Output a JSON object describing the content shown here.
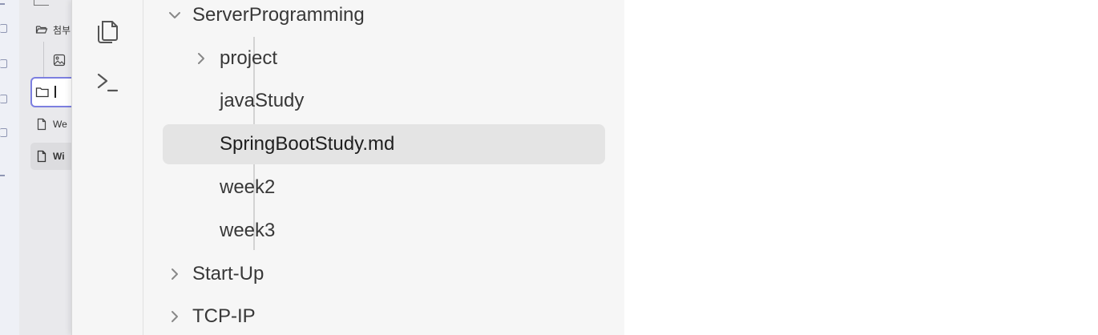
{
  "background_window": {
    "sidebar_items": [
      {
        "icon": "folder-open-icon",
        "label": "첨부"
      },
      {
        "icon": "image-file-icon",
        "label": ""
      },
      {
        "icon": "folder-icon",
        "label": "|",
        "state": "renaming"
      },
      {
        "icon": "file-icon",
        "label": "We"
      },
      {
        "icon": "file-icon",
        "label": "Wi",
        "state": "selected"
      }
    ]
  },
  "overlay": {
    "ribbon": [
      {
        "icon": "files-icon",
        "label": "Files"
      },
      {
        "icon": "terminal-icon",
        "label": "Terminal"
      }
    ],
    "tree": [
      {
        "label": "ServerProgramming",
        "depth": 0,
        "expanded": true,
        "has_children": true
      },
      {
        "label": "project",
        "depth": 1,
        "expanded": false,
        "has_children": true
      },
      {
        "label": "javaStudy",
        "depth": 1,
        "has_children": false
      },
      {
        "label": "SpringBootStudy.md",
        "depth": 1,
        "has_children": false,
        "selected": true
      },
      {
        "label": "week2",
        "depth": 1,
        "has_children": false
      },
      {
        "label": "week3",
        "depth": 1,
        "has_children": false
      },
      {
        "label": "Start-Up",
        "depth": 0,
        "expanded": false,
        "has_children": true
      },
      {
        "label": "TCP-IP",
        "depth": 0,
        "expanded": false,
        "has_children": true
      }
    ]
  },
  "colors": {
    "overlay_bg": "#f6f6f6",
    "selected_row": "#e4e4e4",
    "rename_border": "#7c7fe0",
    "text": "#383838"
  }
}
